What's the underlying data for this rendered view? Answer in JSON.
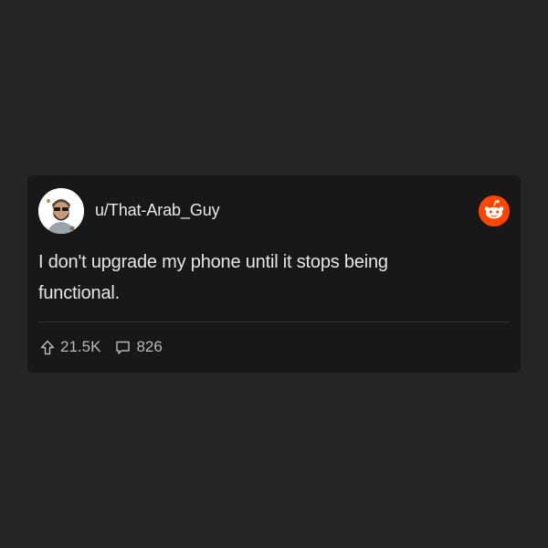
{
  "post": {
    "username": "u/That-Arab_Guy",
    "text": "I don't upgrade my phone until it stops being functional.",
    "upvotes": "21.5K",
    "comments": "826"
  },
  "icons": {
    "avatar": "avatar-icon",
    "brand": "reddit-logo-icon",
    "upvote": "upvote-arrow-icon",
    "comment": "comment-bubble-icon"
  },
  "colors": {
    "background": "#262626",
    "card": "#181818",
    "reddit_orange": "#ff4500",
    "text": "#e6e6e6",
    "muted": "#b9b9b9"
  }
}
